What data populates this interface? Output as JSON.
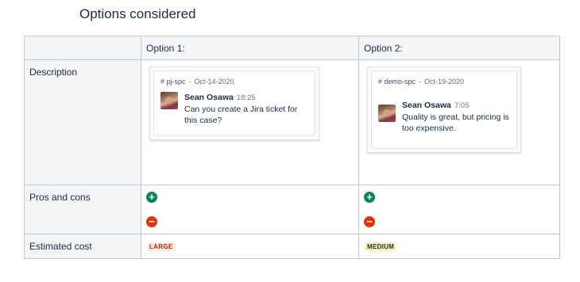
{
  "heading": "Options considered",
  "table": {
    "headers": [
      "",
      "Option 1:",
      "Option 2:"
    ],
    "rows": {
      "description": "Description",
      "pros_cons": "Pros and cons",
      "cost": "Estimated cost"
    }
  },
  "options": [
    {
      "channel": "# pj-spc",
      "date": "Oct-14-2020",
      "author": "Sean Osawa",
      "time": "18:25",
      "message": "Can you create a Jira ticket for this case?",
      "pro_icon": "plus-icon",
      "con_icon": "minus-icon",
      "cost": "LARGE"
    },
    {
      "channel": "# demo-spc",
      "date": "Oct-19-2020",
      "author": "Sean Osawa",
      "time": "7:05",
      "message": "Quality is great, but pricing is too expensive.",
      "pro_icon": "plus-icon",
      "con_icon": "minus-icon",
      "cost": "MEDIUM"
    }
  ],
  "colors": {
    "pro": "#00875a",
    "con": "#de350b",
    "large_lozenge": "#ffebe6",
    "medium_lozenge": "#fff0b3"
  }
}
